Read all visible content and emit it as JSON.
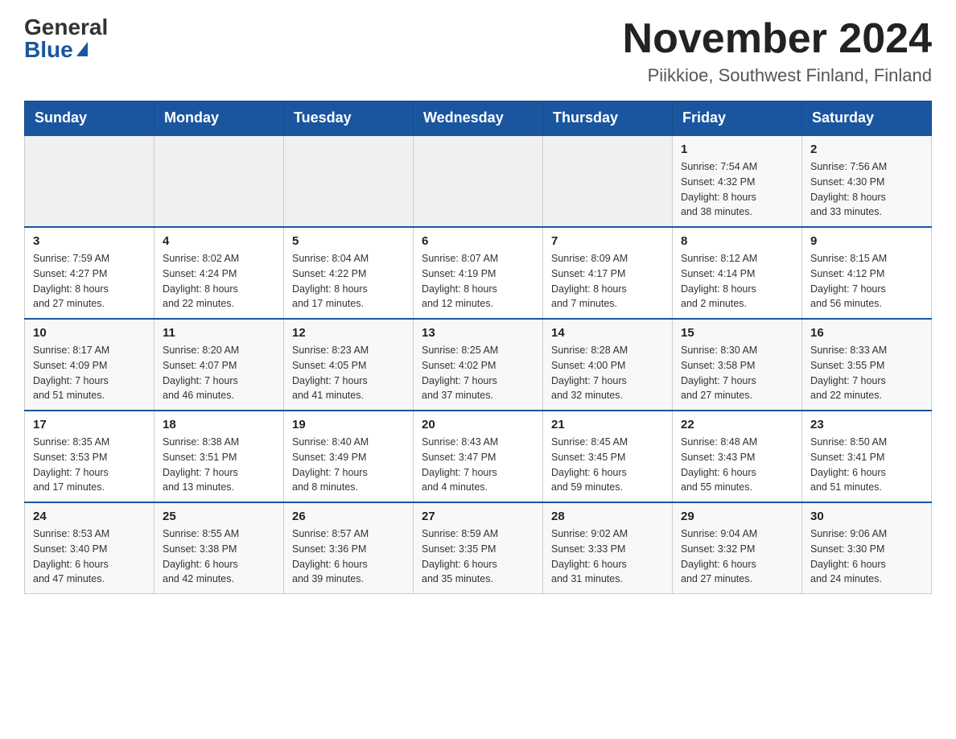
{
  "logo": {
    "general_text": "General",
    "blue_text": "Blue"
  },
  "title": "November 2024",
  "location": "Piikkioe, Southwest Finland, Finland",
  "days_of_week": [
    "Sunday",
    "Monday",
    "Tuesday",
    "Wednesday",
    "Thursday",
    "Friday",
    "Saturday"
  ],
  "weeks": [
    [
      {
        "day": "",
        "info": ""
      },
      {
        "day": "",
        "info": ""
      },
      {
        "day": "",
        "info": ""
      },
      {
        "day": "",
        "info": ""
      },
      {
        "day": "",
        "info": ""
      },
      {
        "day": "1",
        "info": "Sunrise: 7:54 AM\nSunset: 4:32 PM\nDaylight: 8 hours\nand 38 minutes."
      },
      {
        "day": "2",
        "info": "Sunrise: 7:56 AM\nSunset: 4:30 PM\nDaylight: 8 hours\nand 33 minutes."
      }
    ],
    [
      {
        "day": "3",
        "info": "Sunrise: 7:59 AM\nSunset: 4:27 PM\nDaylight: 8 hours\nand 27 minutes."
      },
      {
        "day": "4",
        "info": "Sunrise: 8:02 AM\nSunset: 4:24 PM\nDaylight: 8 hours\nand 22 minutes."
      },
      {
        "day": "5",
        "info": "Sunrise: 8:04 AM\nSunset: 4:22 PM\nDaylight: 8 hours\nand 17 minutes."
      },
      {
        "day": "6",
        "info": "Sunrise: 8:07 AM\nSunset: 4:19 PM\nDaylight: 8 hours\nand 12 minutes."
      },
      {
        "day": "7",
        "info": "Sunrise: 8:09 AM\nSunset: 4:17 PM\nDaylight: 8 hours\nand 7 minutes."
      },
      {
        "day": "8",
        "info": "Sunrise: 8:12 AM\nSunset: 4:14 PM\nDaylight: 8 hours\nand 2 minutes."
      },
      {
        "day": "9",
        "info": "Sunrise: 8:15 AM\nSunset: 4:12 PM\nDaylight: 7 hours\nand 56 minutes."
      }
    ],
    [
      {
        "day": "10",
        "info": "Sunrise: 8:17 AM\nSunset: 4:09 PM\nDaylight: 7 hours\nand 51 minutes."
      },
      {
        "day": "11",
        "info": "Sunrise: 8:20 AM\nSunset: 4:07 PM\nDaylight: 7 hours\nand 46 minutes."
      },
      {
        "day": "12",
        "info": "Sunrise: 8:23 AM\nSunset: 4:05 PM\nDaylight: 7 hours\nand 41 minutes."
      },
      {
        "day": "13",
        "info": "Sunrise: 8:25 AM\nSunset: 4:02 PM\nDaylight: 7 hours\nand 37 minutes."
      },
      {
        "day": "14",
        "info": "Sunrise: 8:28 AM\nSunset: 4:00 PM\nDaylight: 7 hours\nand 32 minutes."
      },
      {
        "day": "15",
        "info": "Sunrise: 8:30 AM\nSunset: 3:58 PM\nDaylight: 7 hours\nand 27 minutes."
      },
      {
        "day": "16",
        "info": "Sunrise: 8:33 AM\nSunset: 3:55 PM\nDaylight: 7 hours\nand 22 minutes."
      }
    ],
    [
      {
        "day": "17",
        "info": "Sunrise: 8:35 AM\nSunset: 3:53 PM\nDaylight: 7 hours\nand 17 minutes."
      },
      {
        "day": "18",
        "info": "Sunrise: 8:38 AM\nSunset: 3:51 PM\nDaylight: 7 hours\nand 13 minutes."
      },
      {
        "day": "19",
        "info": "Sunrise: 8:40 AM\nSunset: 3:49 PM\nDaylight: 7 hours\nand 8 minutes."
      },
      {
        "day": "20",
        "info": "Sunrise: 8:43 AM\nSunset: 3:47 PM\nDaylight: 7 hours\nand 4 minutes."
      },
      {
        "day": "21",
        "info": "Sunrise: 8:45 AM\nSunset: 3:45 PM\nDaylight: 6 hours\nand 59 minutes."
      },
      {
        "day": "22",
        "info": "Sunrise: 8:48 AM\nSunset: 3:43 PM\nDaylight: 6 hours\nand 55 minutes."
      },
      {
        "day": "23",
        "info": "Sunrise: 8:50 AM\nSunset: 3:41 PM\nDaylight: 6 hours\nand 51 minutes."
      }
    ],
    [
      {
        "day": "24",
        "info": "Sunrise: 8:53 AM\nSunset: 3:40 PM\nDaylight: 6 hours\nand 47 minutes."
      },
      {
        "day": "25",
        "info": "Sunrise: 8:55 AM\nSunset: 3:38 PM\nDaylight: 6 hours\nand 42 minutes."
      },
      {
        "day": "26",
        "info": "Sunrise: 8:57 AM\nSunset: 3:36 PM\nDaylight: 6 hours\nand 39 minutes."
      },
      {
        "day": "27",
        "info": "Sunrise: 8:59 AM\nSunset: 3:35 PM\nDaylight: 6 hours\nand 35 minutes."
      },
      {
        "day": "28",
        "info": "Sunrise: 9:02 AM\nSunset: 3:33 PM\nDaylight: 6 hours\nand 31 minutes."
      },
      {
        "day": "29",
        "info": "Sunrise: 9:04 AM\nSunset: 3:32 PM\nDaylight: 6 hours\nand 27 minutes."
      },
      {
        "day": "30",
        "info": "Sunrise: 9:06 AM\nSunset: 3:30 PM\nDaylight: 6 hours\nand 24 minutes."
      }
    ]
  ]
}
